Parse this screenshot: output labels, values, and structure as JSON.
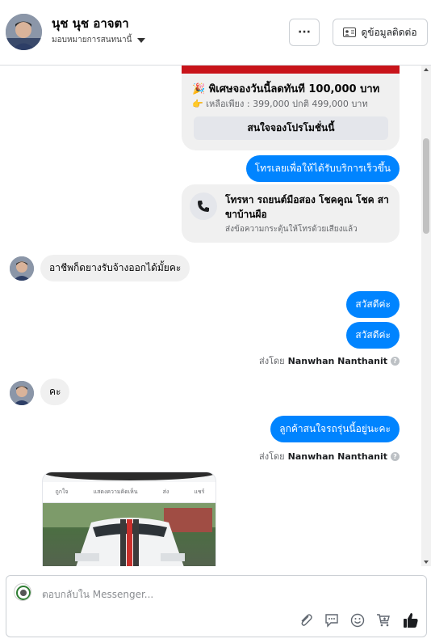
{
  "header": {
    "user_name": "นุช นุช อาจตา",
    "assign_label": "มอบหมายการสนทนานี้",
    "more_label": "···",
    "contact_label": "ดูข้อมูลติดต่อ"
  },
  "promo": {
    "title": "🎉 พิเศษจองวันนี้ลดทันที 100,000 บาท",
    "price": "👉 เหลือเพียง : 399,000  ปกติ 499,000 บาท",
    "button": "สนใจจองโปรโมชั่นนี้"
  },
  "messages": {
    "call_now": "โทรเลยเพื่อให้ได้รับบริการเร็วขึ้น",
    "call_card_title": "โทรหา รถยนต์มือสอง โชคคูณ โชค สาขาบ้านผือ",
    "call_card_sub": "ส่งข้อความกระตุ้นให้โทรด้วยเสียงแล้ว",
    "customer_1": "อาชีพก็ดยางรับจ้างออกได้มั้ยคะ",
    "reply_1": "สวัสดีค่ะ",
    "reply_2": "สวัสดีค่ะ",
    "customer_2": "คะ",
    "reply_3": "ลูกค้าสนใจรถรุ่นนี้อยู่นะคะ"
  },
  "sent_by": {
    "prefix": "ส่งโดย",
    "name": "Nanwhan Nanthanit",
    "info": "?"
  },
  "shared_post": {
    "like": "ถูกใจ",
    "comment": "แสดงความคิดเห็น",
    "send": "ส่ง",
    "share": "แชร์"
  },
  "composer": {
    "placeholder": "ตอบกลับใน Messenger..."
  },
  "colors": {
    "outgoing_bubble": "#0084ff",
    "incoming_bubble": "#f0f0f0",
    "promo_banner": "#c8141a"
  },
  "icons": [
    "more-icon",
    "contact-card-icon",
    "phone-icon",
    "paperclip-icon",
    "saved-reply-icon",
    "emoji-icon",
    "cart-icon",
    "thumbs-up-icon"
  ]
}
